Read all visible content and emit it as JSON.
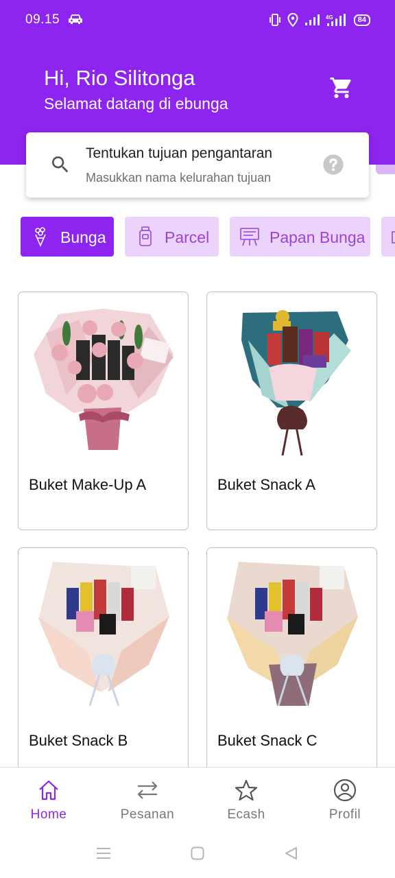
{
  "status_bar": {
    "time": "09.15",
    "network": "4G",
    "battery": "84"
  },
  "header": {
    "greeting": "Hi, Rio Silitonga",
    "subtitle": "Selamat datang di ebunga",
    "accent_color": "#8e24f0"
  },
  "search": {
    "title": "Tentukan tujuan pengantaran",
    "subtitle": "Masukkan nama kelurahan tujuan"
  },
  "categories": [
    {
      "label": "Bunga",
      "icon": "flower-bouquet-icon",
      "active": true
    },
    {
      "label": "Parcel",
      "icon": "parcel-jar-icon",
      "active": false
    },
    {
      "label": "Papan Bunga",
      "icon": "flower-board-icon",
      "active": false
    }
  ],
  "products": [
    {
      "name": "Buket Make-Up A",
      "image": "pink-rose-makeup-bouquet"
    },
    {
      "name": "Buket Snack A",
      "image": "blue-snack-bouquet"
    },
    {
      "name": "Buket Snack B",
      "image": "pink-snack-bouquet"
    },
    {
      "name": "Buket Snack C",
      "image": "mauve-snack-bouquet"
    }
  ],
  "bottom_nav": [
    {
      "label": "Home",
      "icon": "home-icon",
      "active": true
    },
    {
      "label": "Pesanan",
      "icon": "transfer-arrows-icon",
      "active": false
    },
    {
      "label": "Ecash",
      "icon": "star-icon",
      "active": false
    },
    {
      "label": "Profil",
      "icon": "profile-icon",
      "active": false
    }
  ]
}
